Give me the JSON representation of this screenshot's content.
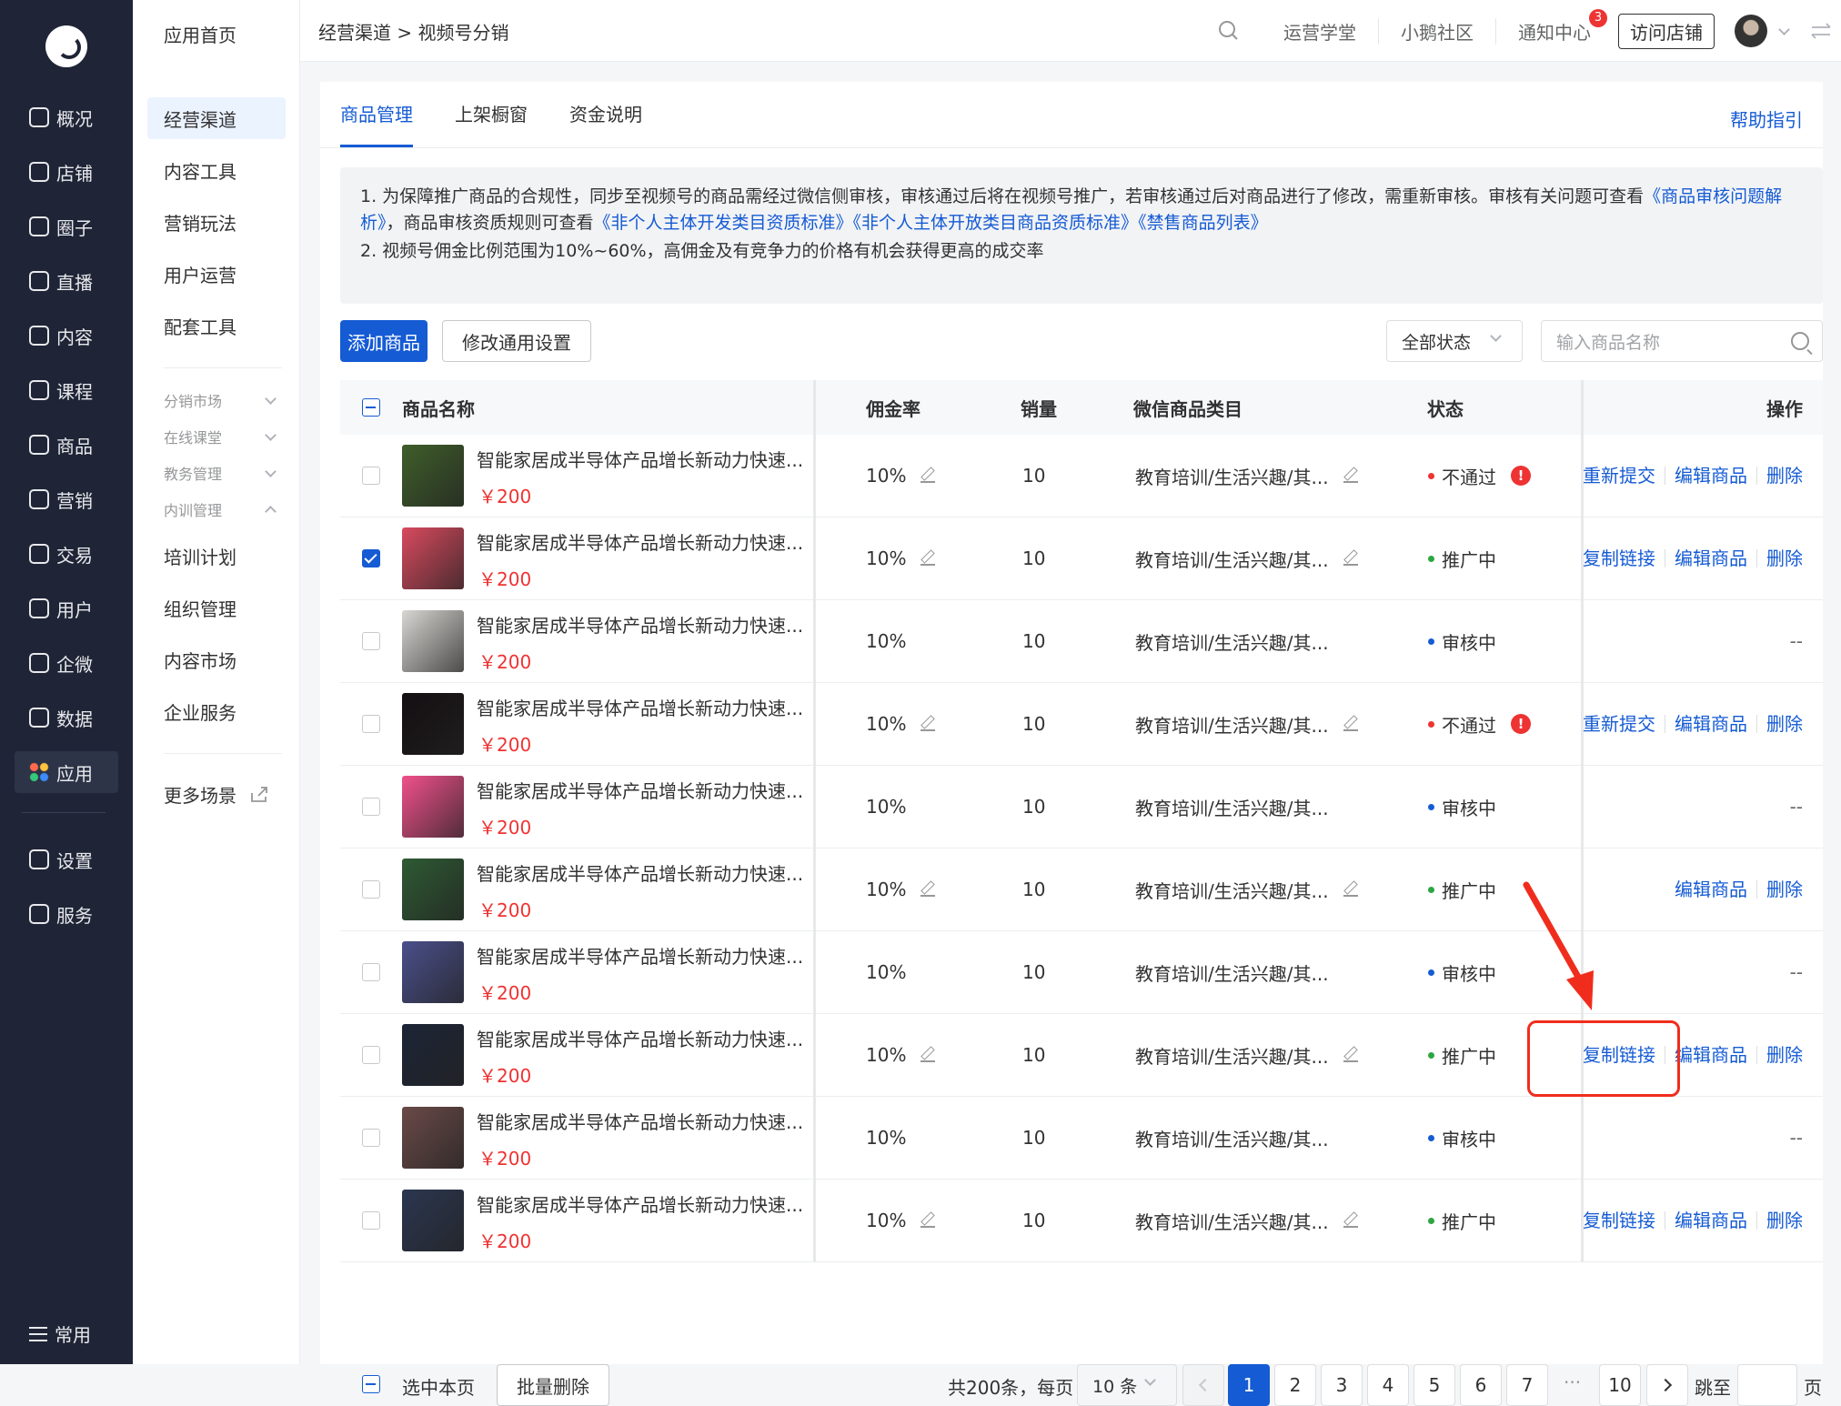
{
  "sidebar": {
    "items": [
      {
        "label": "概况",
        "icon": "overview-icon"
      },
      {
        "label": "店铺",
        "icon": "store-icon"
      },
      {
        "label": "圈子",
        "icon": "community-icon"
      },
      {
        "label": "直播",
        "icon": "live-icon"
      },
      {
        "label": "内容",
        "icon": "content-icon"
      },
      {
        "label": "课程",
        "icon": "course-icon"
      },
      {
        "label": "商品",
        "icon": "product-icon"
      },
      {
        "label": "营销",
        "icon": "marketing-icon"
      },
      {
        "label": "交易",
        "icon": "trade-icon"
      },
      {
        "label": "用户",
        "icon": "user-icon"
      },
      {
        "label": "企微",
        "icon": "wecom-icon"
      },
      {
        "label": "数据",
        "icon": "data-icon"
      },
      {
        "label": "应用",
        "icon": "apps-icon"
      },
      {
        "label": "设置",
        "icon": "settings-icon"
      },
      {
        "label": "服务",
        "icon": "service-icon"
      }
    ],
    "bottom": "常用"
  },
  "subnav": {
    "home": "应用首页",
    "items": [
      "经营渠道",
      "内容工具",
      "营销玩法",
      "用户运营",
      "配套工具"
    ],
    "groups": [
      "分销市场",
      "在线课堂",
      "教务管理",
      "内训管理"
    ],
    "sub_items": [
      "培训计划",
      "组织管理",
      "内容市场",
      "企业服务"
    ],
    "more": "更多场景"
  },
  "topbar": {
    "breadcrumb": "经营渠道 > 视频号分销",
    "links": [
      "运营学堂",
      "小鹅社区",
      "通知中心"
    ],
    "notice_count": "3",
    "visit_store": "访问店铺"
  },
  "tabs": [
    "商品管理",
    "上架橱窗",
    "资金说明"
  ],
  "help": "帮助指引",
  "notice": {
    "line1_a": "1. 为保障推广商品的合规性，同步至视频号的商品需经过微信侧审核，审核通过后将在视频号推广，若审核通过后对商品进行了修改，需重新审核。审核有关问题可查看",
    "link1": "《商品审核问题解析》",
    "line1_b": "，商品审核资质规则可查看",
    "link2": "《非个人主体开发类目资质标准》",
    "link3": "《非个人主体开放类目商品资质标准》",
    "link4": "《禁售商品列表》",
    "line2": "2. 视频号佣金比例范围为10%~60%，高佣金及有竞争力的价格有机会获得更高的成交率"
  },
  "toolbar": {
    "add": "添加商品",
    "settings": "修改通用设置",
    "status_select": "全部状态",
    "search_placeholder": "输入商品名称"
  },
  "table": {
    "headers": [
      "商品名称",
      "佣金率",
      "销量",
      "微信商品类目",
      "状态",
      "操作"
    ],
    "rows": [
      {
        "name": "智能家居成半导体产品增长新动力快速...",
        "price": "￥200",
        "rate": "10%",
        "sales": "10",
        "category": "教育培训/生活兴趣/其...",
        "status": "不通过",
        "status_color": "#e33",
        "ops": [
          "重新提交",
          "编辑商品",
          "删除"
        ],
        "checked": false,
        "editable": true,
        "warn": true,
        "thumb": "#3f5e2a"
      },
      {
        "name": "智能家居成半导体产品增长新动力快速...",
        "price": "￥200",
        "rate": "10%",
        "sales": "10",
        "category": "教育培训/生活兴趣/其...",
        "status": "推广中",
        "status_color": "#2da641",
        "ops": [
          "复制链接",
          "编辑商品",
          "删除"
        ],
        "checked": true,
        "editable": true,
        "warn": false,
        "thumb": "#d84a5e"
      },
      {
        "name": "智能家居成半导体产品增长新动力快速...",
        "price": "￥200",
        "rate": "10%",
        "sales": "10",
        "category": "教育培训/生活兴趣/其...",
        "status": "审核中",
        "status_color": "#155bd4",
        "ops": [],
        "checked": false,
        "editable": false,
        "warn": false,
        "thumb": "#d8d6d2"
      },
      {
        "name": "智能家居成半导体产品增长新动力快速...",
        "price": "￥200",
        "rate": "10%",
        "sales": "10",
        "category": "教育培训/生活兴趣/其...",
        "status": "不通过",
        "status_color": "#e33",
        "ops": [
          "重新提交",
          "编辑商品",
          "删除"
        ],
        "checked": false,
        "editable": true,
        "warn": true,
        "thumb": "#140f12"
      },
      {
        "name": "智能家居成半导体产品增长新动力快速...",
        "price": "￥200",
        "rate": "10%",
        "sales": "10",
        "category": "教育培训/生活兴趣/其...",
        "status": "审核中",
        "status_color": "#155bd4",
        "ops": [],
        "checked": false,
        "editable": false,
        "warn": false,
        "thumb": "#f0508a"
      },
      {
        "name": "智能家居成半导体产品增长新动力快速...",
        "price": "￥200",
        "rate": "10%",
        "sales": "10",
        "category": "教育培训/生活兴趣/其...",
        "status": "推广中",
        "status_color": "#2da641",
        "ops": [
          "编辑商品",
          "删除"
        ],
        "checked": false,
        "editable": true,
        "warn": false,
        "thumb": "#2e5a33"
      },
      {
        "name": "智能家居成半导体产品增长新动力快速...",
        "price": "￥200",
        "rate": "10%",
        "sales": "10",
        "category": "教育培训/生活兴趣/其...",
        "status": "审核中",
        "status_color": "#155bd4",
        "ops": [],
        "checked": false,
        "editable": false,
        "warn": false,
        "thumb": "#4a4f8a"
      },
      {
        "name": "智能家居成半导体产品增长新动力快速...",
        "price": "￥200",
        "rate": "10%",
        "sales": "10",
        "category": "教育培训/生活兴趣/其...",
        "status": "推广中",
        "status_color": "#2da641",
        "ops": [
          "复制链接",
          "编辑商品",
          "删除"
        ],
        "checked": false,
        "editable": true,
        "warn": false,
        "thumb": "#1c2436"
      },
      {
        "name": "智能家居成半导体产品增长新动力快速...",
        "price": "￥200",
        "rate": "10%",
        "sales": "10",
        "category": "教育培训/生活兴趣/其...",
        "status": "审核中",
        "status_color": "#155bd4",
        "ops": [],
        "checked": false,
        "editable": false,
        "warn": false,
        "thumb": "#6a4a48"
      },
      {
        "name": "智能家居成半导体产品增长新动力快速...",
        "price": "￥200",
        "rate": "10%",
        "sales": "10",
        "category": "教育培训/生活兴趣/其...",
        "status": "推广中",
        "status_color": "#2da641",
        "ops": [
          "复制链接",
          "编辑商品",
          "删除"
        ],
        "checked": false,
        "editable": true,
        "warn": false,
        "thumb": "#2b3650"
      }
    ],
    "empty_ops": "--"
  },
  "footer": {
    "select_page": "选中本页",
    "batch_delete": "批量删除",
    "total": "共200条，每页",
    "page_size": "10 条",
    "pages": [
      "1",
      "2",
      "3",
      "4",
      "5",
      "6",
      "7"
    ],
    "ellipsis": "···",
    "last_page": "10",
    "jump_to": "跳至",
    "page_unit": "页"
  }
}
